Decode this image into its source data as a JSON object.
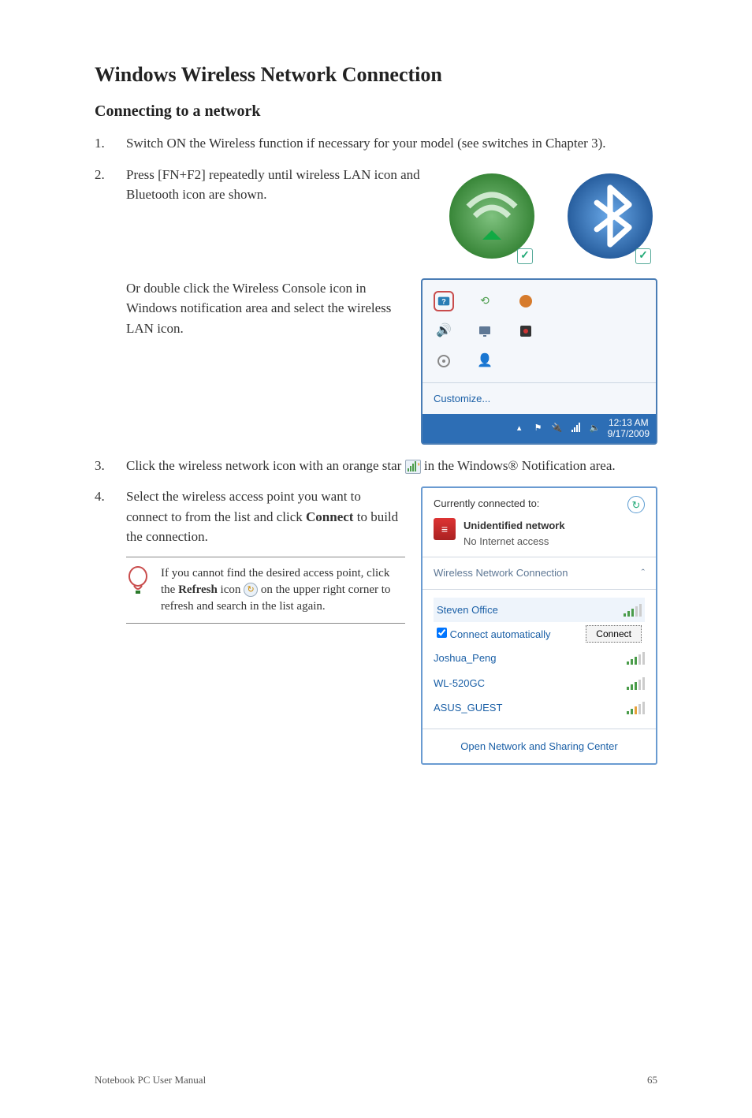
{
  "heading": "Windows Wireless Network Connection",
  "subheading": "Connecting to a network",
  "steps": {
    "s1": "Switch ON the Wireless function if necessary for your model (see switches in Chapter 3).",
    "s2": "Press [FN+F2] repeatedly until wireless LAN icon and Bluetooth icon are shown.",
    "s2b": "Or double click the Wireless Console icon in Windows notification area and select the wireless LAN icon.",
    "s3_pre": "Click the wireless network icon with an orange star ",
    "s3_post": " in the Windows® Notification area.",
    "s4_pre": "Select the wireless access point you want to connect to from the list and click ",
    "s4_bold": "Connect",
    "s4_post": " to build the connection."
  },
  "note": {
    "pre": "If you cannot find the desired access point, click the ",
    "bold": "Refresh",
    "mid": " icon ",
    "post": " on the upper right corner to refresh and search in the list again."
  },
  "tray": {
    "customize": "Customize...",
    "time": "12:13 AM",
    "date": "9/17/2009"
  },
  "netpopup": {
    "connected_to": "Currently connected to:",
    "unidentified": "Unidentified network",
    "no_access": "No Internet access",
    "wnc": "Wireless Network Connection",
    "caret": "ˆ",
    "items": [
      {
        "name": "Steven Office",
        "bars": "fade"
      },
      {
        "name": "Joshua_Peng",
        "bars": "fade"
      },
      {
        "name": "WL-520GC",
        "bars": "fade"
      },
      {
        "name": "ASUS_GUEST",
        "bars": "weak"
      }
    ],
    "auto": "Connect automatically",
    "connect": "Connect",
    "open_center": "Open Network and Sharing Center"
  },
  "footer": {
    "left": "Notebook PC User Manual",
    "right": "65"
  }
}
